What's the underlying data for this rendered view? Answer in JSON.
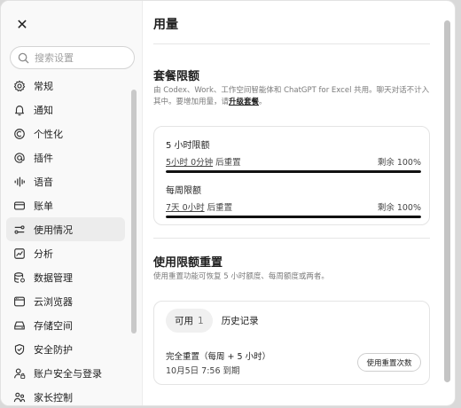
{
  "sidebar": {
    "search_placeholder": "搜索设置",
    "items": [
      {
        "label": "常规",
        "icon": "gear-icon"
      },
      {
        "label": "通知",
        "icon": "bell-icon"
      },
      {
        "label": "个性化",
        "icon": "personalize-icon"
      },
      {
        "label": "插件",
        "icon": "plugin-icon"
      },
      {
        "label": "语音",
        "icon": "voice-icon"
      },
      {
        "label": "账单",
        "icon": "billing-icon"
      },
      {
        "label": "使用情况",
        "icon": "usage-icon",
        "active": true
      },
      {
        "label": "分析",
        "icon": "analytics-icon"
      },
      {
        "label": "数据管理",
        "icon": "database-icon"
      },
      {
        "label": "云浏览器",
        "icon": "cloud-browser-icon"
      },
      {
        "label": "存储空间",
        "icon": "storage-icon"
      },
      {
        "label": "安全防护",
        "icon": "shield-icon"
      },
      {
        "label": "账户安全与登录",
        "icon": "account-lock-icon"
      },
      {
        "label": "家长控制",
        "icon": "parental-icon"
      }
    ]
  },
  "main": {
    "title": "用量",
    "plan": {
      "title": "套餐限额",
      "desc_before": "由 Codex、Work、工作空间智能体和 ChatGPT for Excel 共用。聊天对话不计入其中。要增加用量，请",
      "desc_link": "升级套餐",
      "desc_after": "。",
      "limits": [
        {
          "name": "5 小时限额",
          "reset_time": "5小时 0分钟",
          "reset_suffix": "后重置",
          "remaining": "剩余 100%",
          "fill": 1.0
        },
        {
          "name": "每周限额",
          "reset_time": "7天 0小时",
          "reset_suffix": "后重置",
          "remaining": "剩余 100%",
          "fill": 1.0
        }
      ]
    },
    "reset": {
      "title": "使用限额重置",
      "desc": "使用重置功能可恢复 5 小时额度、每周额度或两者。",
      "tab_available": "可用",
      "tab_available_count": "1",
      "tab_history": "历史记录",
      "item_title": "完全重置（每周 + 5 小时）",
      "item_expiry": "10月5日 7:56 到期",
      "use_button": "使用重置次数"
    }
  }
}
